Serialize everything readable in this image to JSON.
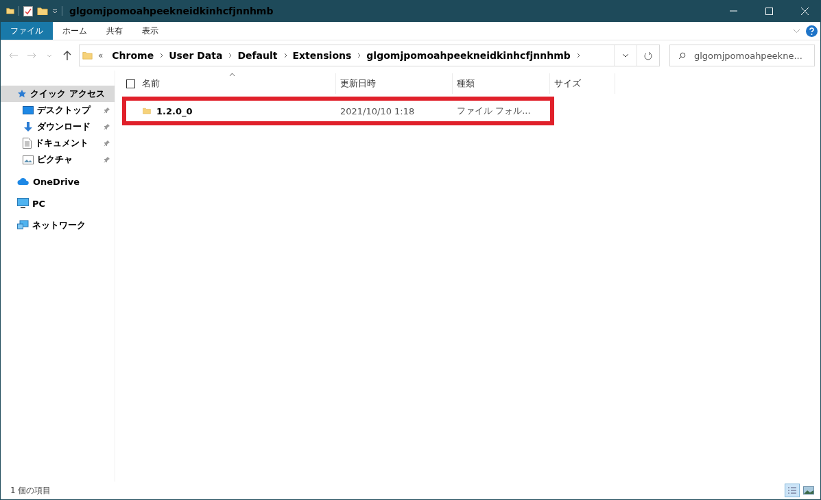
{
  "window": {
    "title": "glgomjpomoahpeekneidkinhcfjnnhmb"
  },
  "ribbon_tabs": [
    {
      "label": "ファイル",
      "selected": true
    },
    {
      "label": "ホーム",
      "selected": false
    },
    {
      "label": "共有",
      "selected": false
    },
    {
      "label": "表示",
      "selected": false
    }
  ],
  "address": {
    "overflow": "«",
    "crumbs": [
      "Chrome",
      "User Data",
      "Default",
      "Extensions",
      "glgomjpomoahpeekneidkinhcfjnnhmb"
    ]
  },
  "search": {
    "placeholder": "glgomjpomoahpeekne..."
  },
  "sidebar": {
    "items": [
      {
        "label": "クイック アクセス",
        "selected": true,
        "pinned": false,
        "children": [
          {
            "label": "デスクトップ",
            "selected": false,
            "pinned": true
          },
          {
            "label": "ダウンロード",
            "selected": false,
            "pinned": true
          },
          {
            "label": "ドキュメント",
            "selected": false,
            "pinned": true
          },
          {
            "label": "ピクチャ",
            "selected": false,
            "pinned": true
          }
        ]
      },
      {
        "label": "OneDrive",
        "selected": false,
        "pinned": false
      },
      {
        "label": "PC",
        "selected": false,
        "pinned": false
      },
      {
        "label": "ネットワーク",
        "selected": false,
        "pinned": false
      }
    ]
  },
  "table": {
    "columns": [
      "名前",
      "更新日時",
      "種類",
      "サイズ"
    ],
    "select_all_checked": false,
    "rows": [
      {
        "name": "1.2.0_0",
        "modified": "2021/10/10 1:18",
        "type": "ファイル フォル...",
        "size": "",
        "highlighted": true
      }
    ]
  },
  "status_bar": {
    "text": "1 個の項目",
    "views": [
      {
        "selected": true
      },
      {
        "selected": false
      }
    ]
  }
}
